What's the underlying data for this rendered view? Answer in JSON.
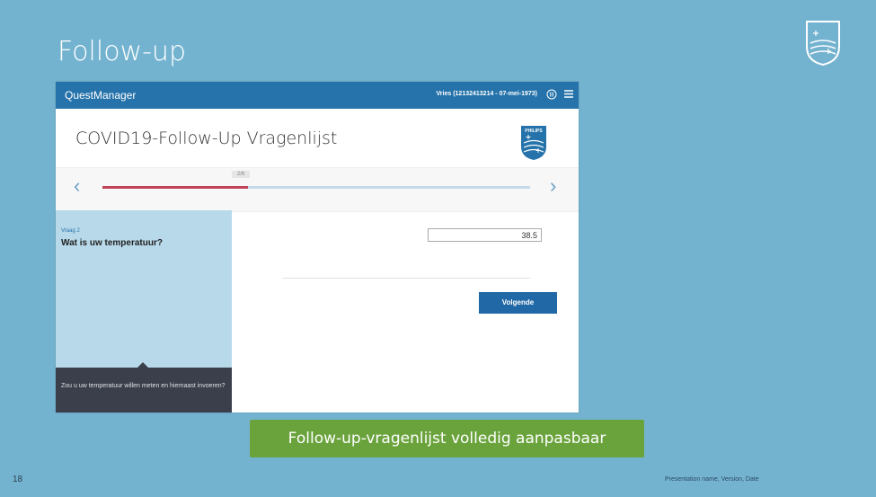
{
  "slide": {
    "title": "Follow-up",
    "caption": "Follow-up-vragenlijst volledig aanpasbaar",
    "page_number": "18",
    "footer": "Presentation name, Version, Date"
  },
  "app": {
    "name": "QuestManager",
    "patient": "Vries (12132413214 - 07-mei-1973)",
    "questionnaire_title": "COVID19-Follow-Up Vragenlijst",
    "step": "2/6",
    "progress_fraction": 0.34,
    "question_label": "Vraag 2",
    "question_text": "Wat is uw temperatuur?",
    "temperature_value": "38.5",
    "next_button": "Volgende",
    "help_text": "Zou u uw temperatuur willen meten en hiernaast invoeren?",
    "brand_logo_text": "PHILIPS"
  },
  "icons": {
    "prev": "chevron-left-icon",
    "next": "chevron-right-icon",
    "pause": "pause-icon",
    "menu": "hamburger-menu-icon"
  },
  "colors": {
    "slide_bg": "#74b3d0",
    "header_bg": "#2573aa",
    "progress_fill": "#c0435a",
    "caption_bg": "#6aa33c",
    "button_bg": "#2068a6"
  }
}
